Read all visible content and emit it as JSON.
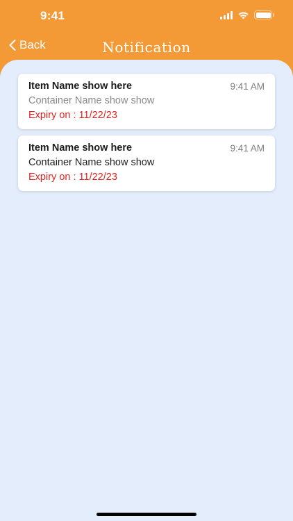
{
  "status_bar": {
    "time": "9:41"
  },
  "nav": {
    "back_label": "Back",
    "title": "Notification"
  },
  "notifications": [
    {
      "item_name": "Item Name show here",
      "time": "9:41 AM",
      "container": "Container Name show show",
      "expiry": "Expiry on : 11/22/23",
      "read": true
    },
    {
      "item_name": "Item Name show here",
      "time": "9:41 AM",
      "container": "Container Name show show",
      "expiry": "Expiry on : 11/22/23",
      "read": false
    }
  ],
  "colors": {
    "header": "#f39a36",
    "background": "#e4edfb",
    "expiry": "#e0231e"
  },
  "icons": {
    "back": "chevron-left-icon",
    "signal": "cellular-signal-icon",
    "wifi": "wifi-icon",
    "battery": "battery-icon"
  }
}
